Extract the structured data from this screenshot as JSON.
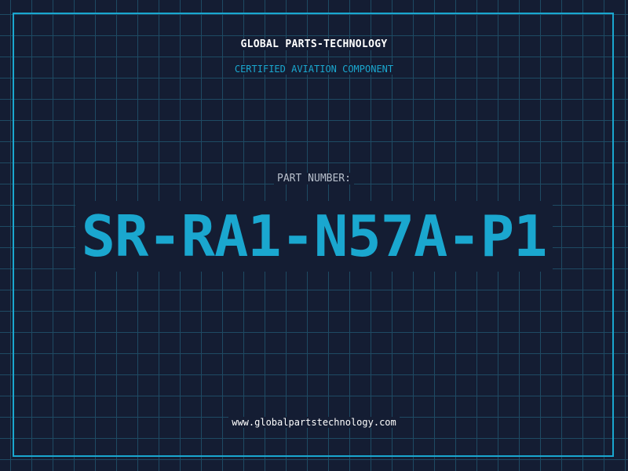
{
  "header": {
    "company": "GLOBAL PARTS-TECHNOLOGY",
    "tagline": "CERTIFIED AVIATION COMPONENT"
  },
  "part": {
    "label": "PART NUMBER:",
    "number": "SR-RA1-N57A-P1"
  },
  "footer": {
    "website": "www.globalpartstechnology.com"
  },
  "colors": {
    "background": "#141d33",
    "grid": "#1e4a63",
    "accent": "#1aa7cf",
    "text": "#ffffff",
    "muted": "#b8c0cc"
  }
}
